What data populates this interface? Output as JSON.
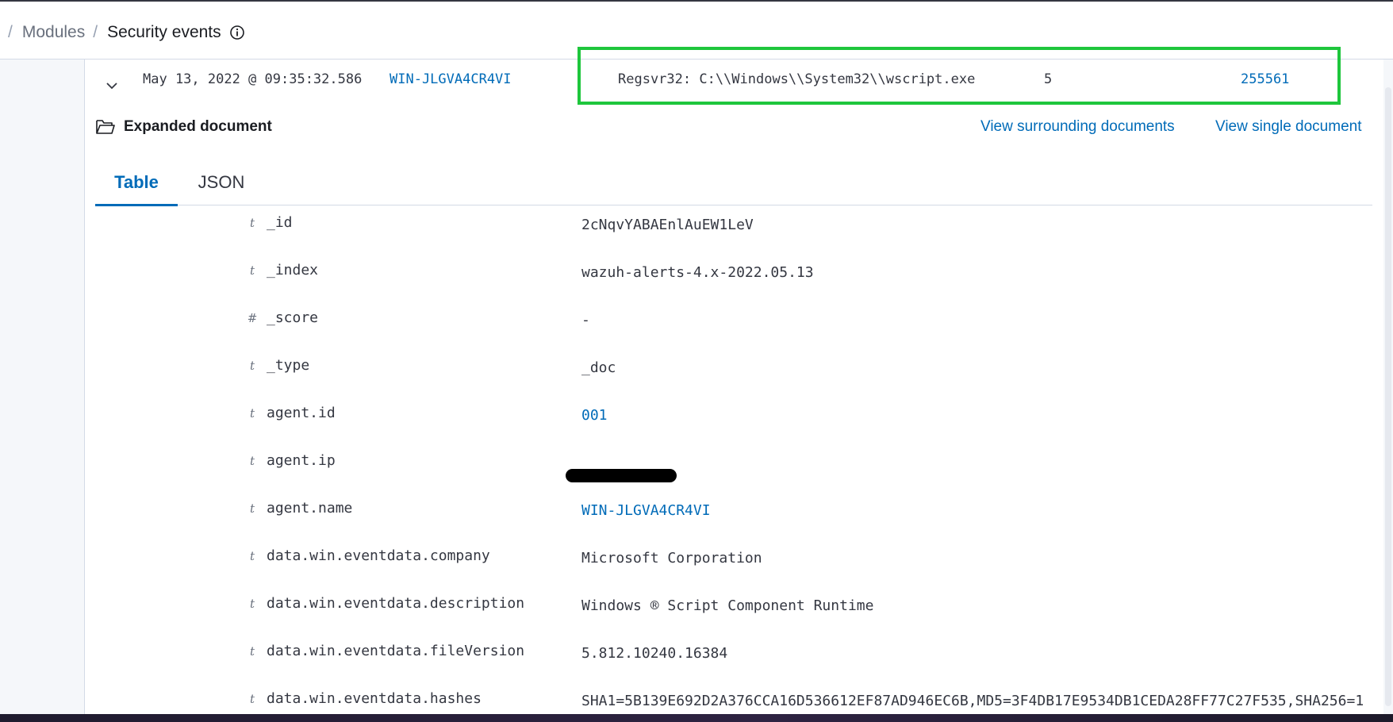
{
  "breadcrumbs": {
    "separator": "/",
    "modules": "Modules",
    "current": "Security events"
  },
  "document_row": {
    "timestamp": "May 13, 2022 @ 09:35:32.586",
    "agent_name": "WIN-JLGVA4CR4VI",
    "description": "Regsvr32: C:\\\\Windows\\\\System32\\\\wscript.exe",
    "level": "5",
    "rule_id": "255561"
  },
  "highlight_color": "#1ec63c",
  "expanded": {
    "title": "Expanded document",
    "view_surrounding": "View surrounding documents",
    "view_single": "View single document"
  },
  "tabs": [
    {
      "label": "Table",
      "active": true
    },
    {
      "label": "JSON",
      "active": false
    }
  ],
  "fields": [
    {
      "type": "t",
      "name": "_id",
      "value": "2cNqvYABAEnlAuEW1LeV"
    },
    {
      "type": "t",
      "name": "_index",
      "value": "wazuh-alerts-4.x-2022.05.13"
    },
    {
      "type": "#",
      "name": "_score",
      "value": " -"
    },
    {
      "type": "t",
      "name": "_type",
      "value": "_doc"
    },
    {
      "type": "t",
      "name": "agent.id",
      "value": "001",
      "link": true
    },
    {
      "type": "t",
      "name": "agent.ip",
      "value": "",
      "redacted": true
    },
    {
      "type": "t",
      "name": "agent.name",
      "value": "WIN-JLGVA4CR4VI",
      "link": true
    },
    {
      "type": "t",
      "name": "data.win.eventdata.company",
      "value": "Microsoft Corporation"
    },
    {
      "type": "t",
      "name": "data.win.eventdata.description",
      "value": "Windows ® Script Component Runtime"
    },
    {
      "type": "t",
      "name": "data.win.eventdata.fileVersion",
      "value": "5.812.10240.16384"
    },
    {
      "type": "t",
      "name": "data.win.eventdata.hashes",
      "value": "SHA1=5B139E692D2A376CCA16D536612EF87AD946EC6B,MD5=3F4DB17E9534DB1CEDA28FF77C27F535,SHA256=1"
    }
  ],
  "colors": {
    "link": "#006bb8",
    "text": "#343741",
    "muted": "#69707d"
  }
}
